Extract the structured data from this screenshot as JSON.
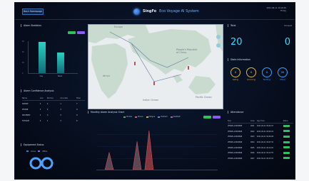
{
  "header": {
    "menu_button": "Back Homepage",
    "brand_name": "SingFo",
    "brand_subtitle": "Eco Voyage AI System",
    "datetime_line1": "2021-06-11 10:16:49",
    "datetime_line2": "Friday"
  },
  "left": {
    "alarm_panel": {
      "title": "Alarm Statistics",
      "y_ticks": [
        "60",
        "40",
        "20",
        "0"
      ],
      "bars": [
        {
          "label": "Day",
          "value": 60
        },
        {
          "label": "Week",
          "value": 40
        }
      ],
      "legend_colors": [
        "#2fc25b",
        "#8a5cf6"
      ]
    },
    "conf_panel": {
      "title": "Alarm Confidence Analysis",
      "columns": [
        "Name",
        "Low",
        "Normal",
        "Accurate",
        "Total"
      ],
      "rows": [
        [
          "SMOKE",
          "4",
          "2",
          "1",
          "7"
        ],
        [
          "PHONE",
          "3",
          "4",
          "2",
          "9"
        ],
        [
          "SEATBELT",
          "1",
          "3",
          "5",
          "9"
        ],
        [
          "FATIGUE",
          "2",
          "1",
          "3",
          "6"
        ]
      ]
    },
    "equip_panel": {
      "title": "Equipment Status",
      "legend": [
        "Online",
        "Offline"
      ],
      "legend_colors": [
        "#2f7cf6",
        "#8a5cf6"
      ]
    }
  },
  "map": {
    "labels": [
      "Europe",
      "People's Republic of China",
      "Africa",
      "Indian Ocean",
      "Pacific Ocean"
    ],
    "colors": {
      "land": "#c9dbcf",
      "water": "#e9edf0",
      "route": "#5a7aa0"
    }
  },
  "timeline": {
    "title": "Monthly Alarm Analysis Chart",
    "legend": [
      "Smoke",
      "Phone",
      "Fatigue",
      "Distract",
      "Seatbelt"
    ],
    "legend_colors": [
      "#4caf50",
      "#e85a5a",
      "#d8a83c",
      "#5a8ef0",
      "#c04ec0"
    ],
    "chip_colors": [
      "#2fc25b",
      "#8a5cf6"
    ],
    "series_peaks": [
      {
        "day": 3,
        "value": 40
      },
      {
        "day": 10,
        "value": 65
      },
      {
        "day": 13,
        "value": 90
      }
    ]
  },
  "right": {
    "stats": {
      "total_label": "Total",
      "total_value": "20",
      "unread_label": "Unread",
      "unread_value": "0"
    },
    "state": {
      "title": "State Information",
      "items": [
        {
          "value": "0",
          "label": "Sailing",
          "color": "gold"
        },
        {
          "value": "0",
          "label": "Anchoring",
          "color": "gold"
        },
        {
          "value": "0",
          "label": "Berthing",
          "color": "blue"
        },
        {
          "value": "20",
          "label": "Others",
          "color": "blue"
        }
      ]
    },
    "attendance": {
      "title": "Attendance",
      "columns": [
        "Ship",
        "Crew",
        "Sign Time",
        "Status"
      ],
      "rows": [
        [
          "VESSEL-22000868",
          "0001",
          "2021-06-11 09:02:15"
        ],
        [
          "VESSEL-22000868",
          "0002",
          "2021-06-11 09:04:41"
        ],
        [
          "VESSEL-22000868",
          "0003",
          "2021-06-11 09:06:08"
        ],
        [
          "VESSEL-22000868",
          "0004",
          "2021-06-11 09:07:32"
        ],
        [
          "VESSEL-22000868",
          "0005",
          "2021-06-11 09:10:20"
        ],
        [
          "VESSEL-22000868",
          "0006",
          "2021-06-11 09:12:55"
        ],
        [
          "VESSEL-22000868",
          "0007",
          "2021-06-11 09:15:03"
        ]
      ],
      "status_color": "#2fc25b"
    }
  }
}
